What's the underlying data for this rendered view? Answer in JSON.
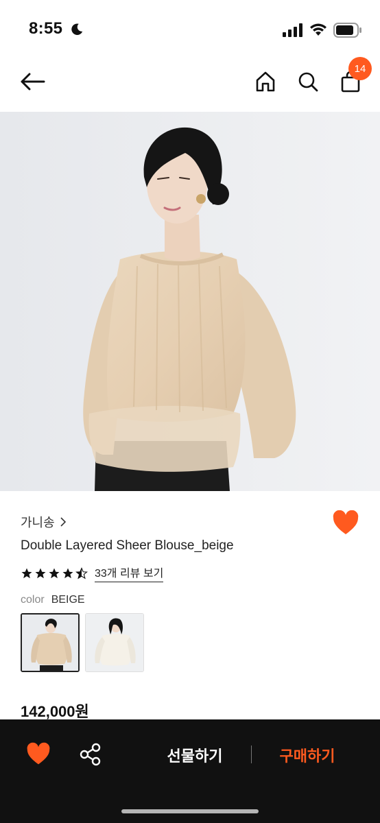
{
  "status": {
    "time": "8:55"
  },
  "nav": {
    "cart_count": "14"
  },
  "product": {
    "brand": "가니송",
    "title": "Double Layered Sheer Blouse_beige",
    "rating": 4.5,
    "review_link": "33개 리뷰 보기",
    "color_label": "color",
    "color_value": "BEIGE",
    "price": "142,000원"
  },
  "bottom": {
    "gift_label": "선물하기",
    "buy_label": "구매하기"
  },
  "colors": {
    "accent": "#ff5a1f",
    "bottom_bar": "#111111"
  },
  "icons": [
    "moon-icon",
    "signal-icon",
    "wifi-icon",
    "battery-icon",
    "back-arrow-icon",
    "home-icon",
    "search-icon",
    "shopping-bag-icon",
    "heart-icon",
    "share-icon",
    "star-icon",
    "chevron-right-icon"
  ]
}
